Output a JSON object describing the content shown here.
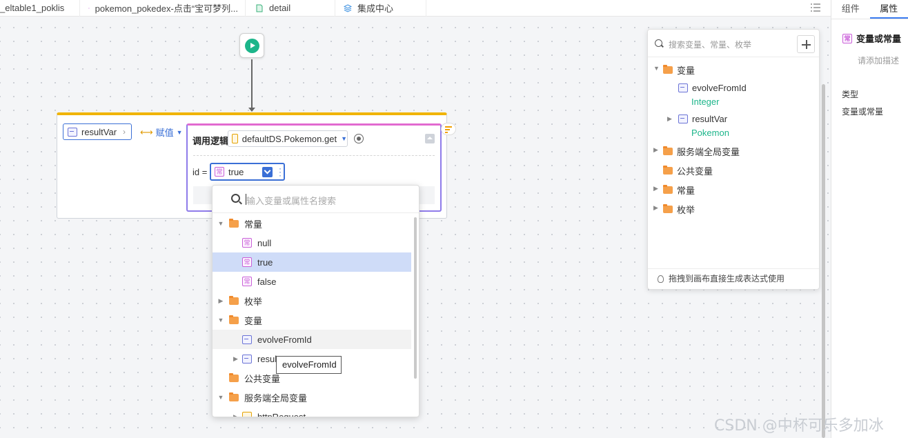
{
  "tabs": [
    {
      "label": "_eltable1_poklis",
      "icon": "none"
    },
    {
      "label": "pokemon_pokedex-点击“宝可梦列...",
      "icon": "logic-icon"
    },
    {
      "label": "detail",
      "icon": "page-icon"
    },
    {
      "label": "集成中心",
      "icon": "stack-icon"
    }
  ],
  "props_panel": {
    "tab_component": "组件",
    "tab_properties": "属性",
    "name": "变量或常量",
    "description_placeholder": "请添加描述",
    "type_label": "类型",
    "type_value": "变量或常量",
    "const_icon_char": "常"
  },
  "node": {
    "result_var": "resultVar",
    "assign_label": "赋值",
    "logic_title": "调用逻辑",
    "logic_target": "defaultDS.Pokemon.get",
    "param_label": "id =",
    "param_value": "true"
  },
  "dropdown": {
    "placeholder": "输入变量或属性名搜索",
    "items": [
      {
        "label": "常量",
        "kind": "folder",
        "arrow": "▼"
      },
      {
        "label": "null",
        "kind": "const"
      },
      {
        "label": "true",
        "kind": "const",
        "selected": true
      },
      {
        "label": "false",
        "kind": "const"
      },
      {
        "label": "枚举",
        "kind": "folder",
        "arrow": "▶"
      },
      {
        "label": "变量",
        "kind": "folder",
        "arrow": "▼"
      },
      {
        "label": "evolveFromId",
        "kind": "var",
        "hovered": true
      },
      {
        "label": "resultV",
        "kind": "var",
        "arrow": "▶"
      },
      {
        "label": "公共变量",
        "kind": "folder"
      },
      {
        "label": "服务端全局变量",
        "kind": "folder",
        "arrow": "▼"
      },
      {
        "label": "httpRequest",
        "kind": "struct",
        "arrow": "▶"
      }
    ],
    "tooltip": "evolveFromId"
  },
  "var_panel": {
    "placeholder": "搜索变量、常量、枚举",
    "variables_label": "变量",
    "evolve_name": "evolveFromId",
    "evolve_type": "Integer",
    "result_name": "resultVar",
    "result_type": "Pokemon",
    "server_global_label": "服务端全局变量",
    "public_label": "公共变量",
    "constants_label": "常量",
    "enums_label": "枚举",
    "footer": "拖拽到画布直接生成表达式使用"
  },
  "watermark": "CSDN @中杯可乐多加冰",
  "colors": {
    "accent_blue": "#3a6fd6",
    "type_green": "#1cb58a",
    "assign_yellow": "#f0b400",
    "logic_pink": "#e26ad0",
    "folder_orange": "#f5a04a"
  }
}
